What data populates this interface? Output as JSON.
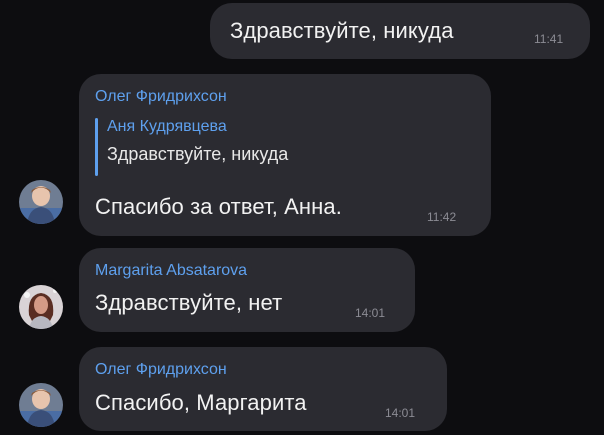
{
  "messages": [
    {
      "text": "Здравствуйте, никуда",
      "time": "11:41"
    },
    {
      "sender": "Олег Фридрихсон",
      "reply": {
        "author": "Аня Кудрявцева",
        "text": "Здравствуйте, никуда"
      },
      "text": "Спасибо за ответ, Анна.",
      "time": "11:42",
      "avatar": "avatar-male-icon"
    },
    {
      "sender": "Margarita Absatarova",
      "text": "Здравствуйте, нет",
      "time": "14:01",
      "avatar": "avatar-female-icon"
    },
    {
      "sender": "Олег Фридрихсон",
      "text": "Спасибо, Маргарита",
      "time": "14:01",
      "avatar": "avatar-male-icon"
    }
  ],
  "colors": {
    "background": "#0d0d10",
    "bubble": "#2b2b31",
    "name": "#5ea0ee",
    "text": "#f2f2f2",
    "time": "#8c8c94"
  }
}
